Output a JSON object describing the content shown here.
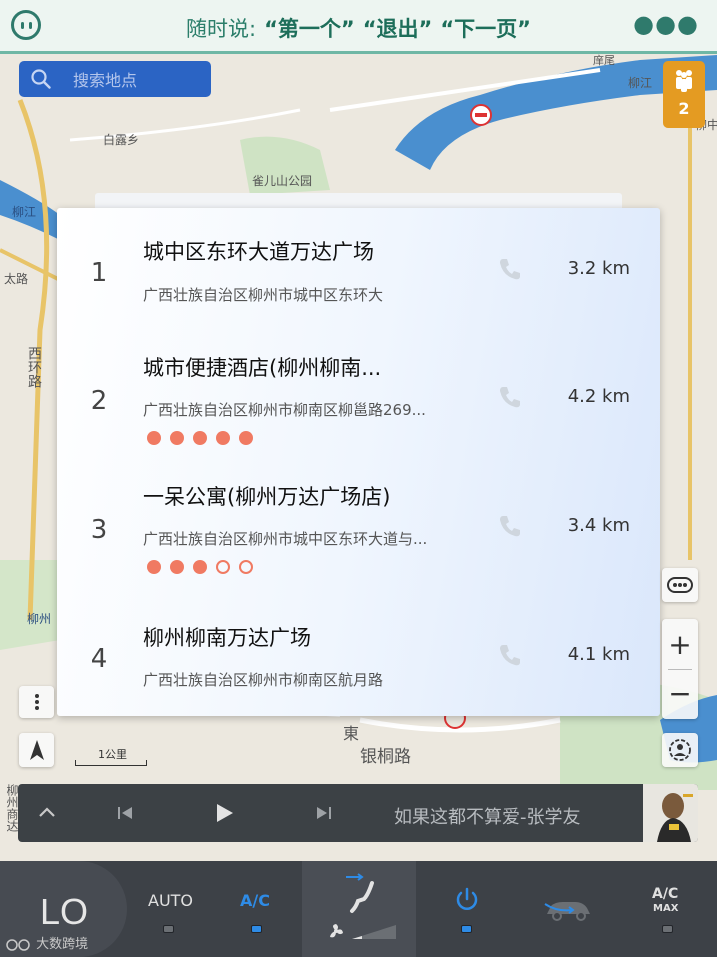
{
  "voice": {
    "prefix": "随时说:",
    "commands": [
      "“第一个”",
      "“退出”",
      "“下一页”"
    ]
  },
  "search": {
    "placeholder": "搜索地点"
  },
  "traffic": {
    "count": "2"
  },
  "map_labels": {
    "bailu": "白露乡",
    "queershan": "雀儿山公园",
    "liujiang": "柳江",
    "taida": "太路",
    "xihuan": "西环路",
    "liuzhou": "柳州",
    "yintong": "银桐路",
    "right_edge": "柳中",
    "top_right": "庠尾",
    "top_right2": "柳江",
    "dong": "東",
    "wanda_partial": "柳州",
    "bottom_left": "柳州商达"
  },
  "results": [
    {
      "index": "1",
      "name": "城中区东环大道万达广场",
      "address": "广西壮族自治区柳州市城中区东环大",
      "distance": "3.2 km",
      "rating": null
    },
    {
      "index": "2",
      "name": "城市便捷酒店(柳州柳南...",
      "address": "广西壮族自治区柳州市柳南区柳邕路269...",
      "distance": "4.2 km",
      "rating": 5
    },
    {
      "index": "3",
      "name": "一呆公寓(柳州万达广场店)",
      "address": "广西壮族自治区柳州市城中区东环大道与...",
      "distance": "3.4 km",
      "rating": 3
    },
    {
      "index": "4",
      "name": "柳州柳南万达广场",
      "address": "广西壮族自治区柳州市柳南区航月路",
      "distance": "4.1 km",
      "rating": null
    }
  ],
  "map_controls": {
    "zoom_in": "+",
    "zoom_out": "−",
    "scale": "1公里"
  },
  "media": {
    "song": "如果这都不算爱-张学友"
  },
  "climate": {
    "temperature": "LO",
    "auto_label": "AUTO",
    "ac_label": "A/C",
    "acmax_label_top": "A/C",
    "acmax_label_bottom": "MAX",
    "auto_on": false,
    "ac_on": true,
    "power_on": true,
    "acmax_on": false
  },
  "watermark": "大数跨境",
  "colors": {
    "voice_text": "#2b7e6a",
    "search_bg": "#2b64c4",
    "traffic_bg": "#e49b22",
    "rating": "#f07a62",
    "active_blue": "#2e8be6"
  }
}
